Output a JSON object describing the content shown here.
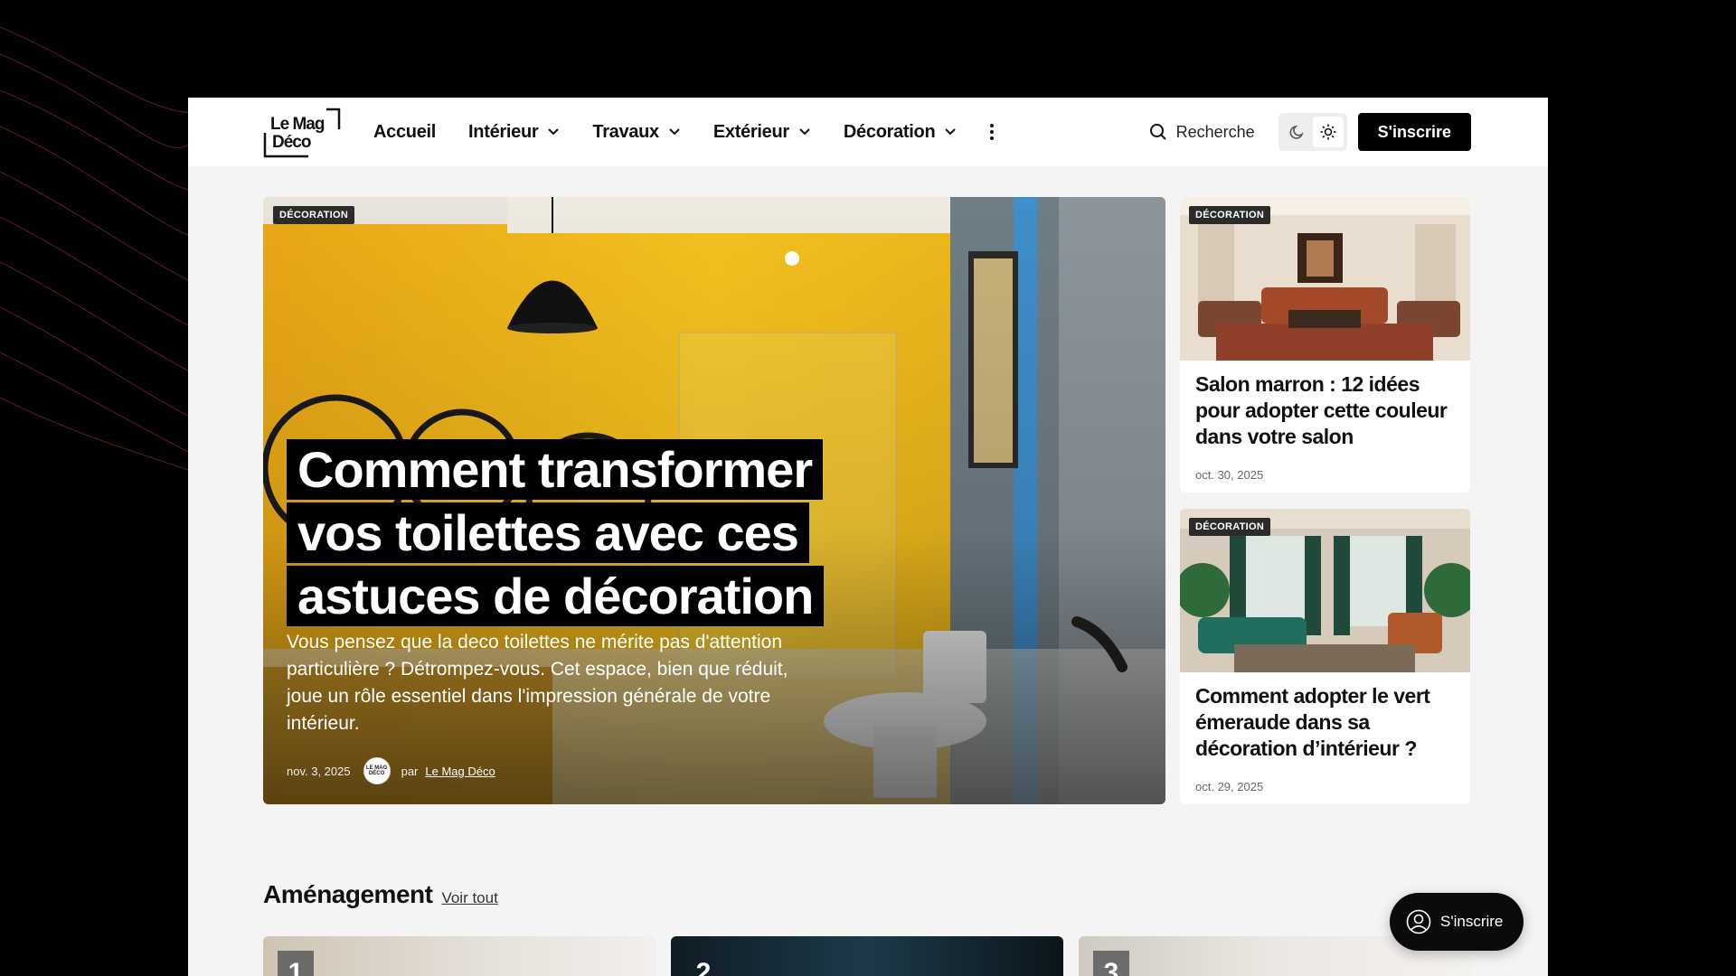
{
  "colors": {
    "accent": "#000000",
    "background": "#f4f4f5",
    "hero_wall": "#f2b81c",
    "page_outer": "#000000",
    "lines": "#7a1f56"
  },
  "logo": {
    "line1": "Le Mag",
    "line2": "Déco"
  },
  "nav": {
    "items": [
      {
        "label": "Accueil",
        "dropdown": false
      },
      {
        "label": "Intérieur",
        "dropdown": true
      },
      {
        "label": "Travaux",
        "dropdown": true
      },
      {
        "label": "Extérieur",
        "dropdown": true
      },
      {
        "label": "Décoration",
        "dropdown": true
      }
    ],
    "more_icon": "more-vertical-icon"
  },
  "header": {
    "search_label": "Recherche",
    "search_icon": "search-icon",
    "theme_icons": [
      "moon-icon",
      "sun-icon"
    ],
    "signup_label": "S'inscrire"
  },
  "hero": {
    "badge": "DÉCORATION",
    "title_lines": [
      "Comment transformer",
      "vos toilettes avec ces",
      "astuces de décoration"
    ],
    "excerpt": "Vous pensez que la deco toilettes ne mérite pas d'attention particulière ? Détrompez-vous. Cet espace, bien que réduit, joue un rôle essentiel dans l'impression générale de votre intérieur.",
    "date": "nov. 3, 2025",
    "by": "par",
    "author": "Le Mag Déco",
    "avatar_text": "LE MAG DÉCO"
  },
  "side_cards": [
    {
      "badge": "DÉCORATION",
      "title": "Salon marron : 12 idées pour adopter cette couleur dans votre salon",
      "date": "oct. 30, 2025"
    },
    {
      "badge": "DÉCORATION",
      "title": "Comment adopter le vert émeraude dans sa décoration d’intérieur ?",
      "date": "oct. 29, 2025"
    }
  ],
  "section": {
    "title": "Aménagement",
    "see_all": "Voir tout",
    "cards": [
      {
        "num": "1"
      },
      {
        "num": "2"
      },
      {
        "num": "3"
      }
    ]
  },
  "floating": {
    "signup_label": "S'inscrire",
    "icon": "user-circle-icon"
  }
}
